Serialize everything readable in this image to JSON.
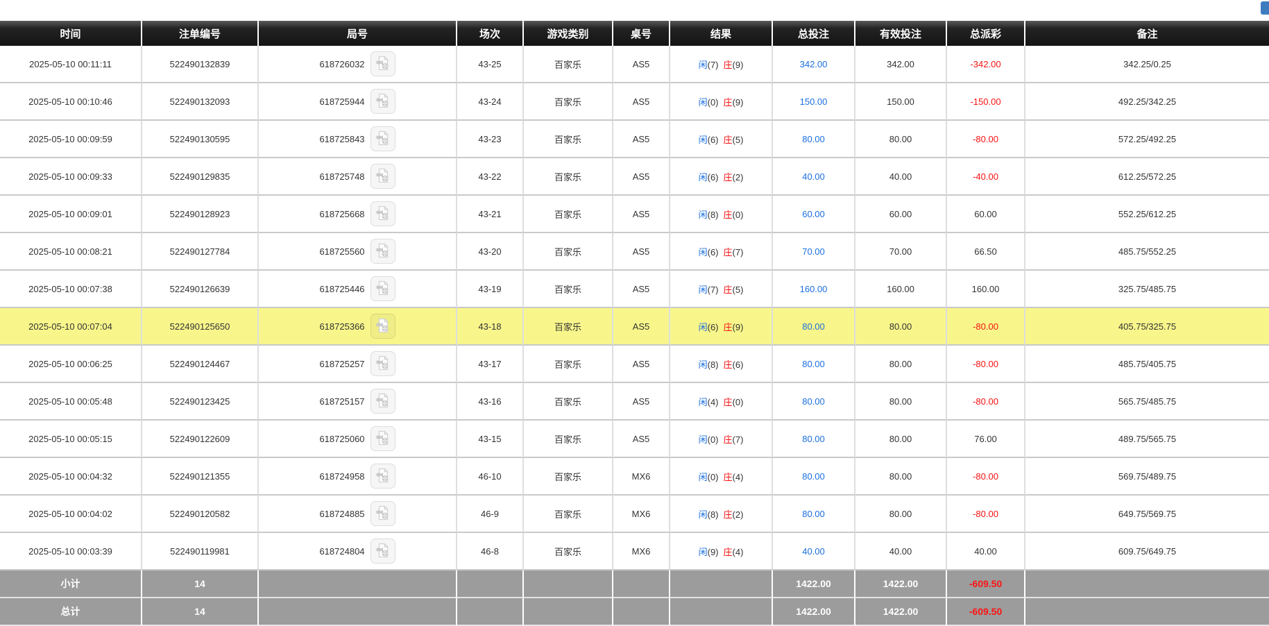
{
  "top_bar": {
    "partial_blue_button": {
      "visible": true,
      "color": "#3d7dbf"
    }
  },
  "table": {
    "columns": [
      {
        "key": "time",
        "label": "时间"
      },
      {
        "key": "bet_id",
        "label": "注单编号"
      },
      {
        "key": "round",
        "label": "局号"
      },
      {
        "key": "session",
        "label": "场次"
      },
      {
        "key": "game_type",
        "label": "游戏类别"
      },
      {
        "key": "table_no",
        "label": "桌号"
      },
      {
        "key": "result",
        "label": "结果"
      },
      {
        "key": "total_bet",
        "label": "总投注"
      },
      {
        "key": "valid_bet",
        "label": "有效投注"
      },
      {
        "key": "payout",
        "label": "总派彩"
      },
      {
        "key": "remark",
        "label": "备注"
      }
    ],
    "result_labels": {
      "player": "闲",
      "banker": "庄"
    },
    "rows": [
      {
        "time": "2025-05-10 00:11:11",
        "bet_id": "522490132839",
        "round": "618726032",
        "session": "43-25",
        "game": "百家乐",
        "table_no": "AS5",
        "p": "(7)",
        "b": "(9)",
        "total_bet": "342.00",
        "valid_bet": "342.00",
        "payout": "-342.00",
        "remark": "342.25/0.25",
        "highlight": false
      },
      {
        "time": "2025-05-10 00:10:46",
        "bet_id": "522490132093",
        "round": "618725944",
        "session": "43-24",
        "game": "百家乐",
        "table_no": "AS5",
        "p": "(0)",
        "b": "(9)",
        "total_bet": "150.00",
        "valid_bet": "150.00",
        "payout": "-150.00",
        "remark": "492.25/342.25",
        "highlight": false
      },
      {
        "time": "2025-05-10 00:09:59",
        "bet_id": "522490130595",
        "round": "618725843",
        "session": "43-23",
        "game": "百家乐",
        "table_no": "AS5",
        "p": "(6)",
        "b": "(5)",
        "total_bet": "80.00",
        "valid_bet": "80.00",
        "payout": "-80.00",
        "remark": "572.25/492.25",
        "highlight": false
      },
      {
        "time": "2025-05-10 00:09:33",
        "bet_id": "522490129835",
        "round": "618725748",
        "session": "43-22",
        "game": "百家乐",
        "table_no": "AS5",
        "p": "(6)",
        "b": "(2)",
        "total_bet": "40.00",
        "valid_bet": "40.00",
        "payout": "-40.00",
        "remark": "612.25/572.25",
        "highlight": false
      },
      {
        "time": "2025-05-10 00:09:01",
        "bet_id": "522490128923",
        "round": "618725668",
        "session": "43-21",
        "game": "百家乐",
        "table_no": "AS5",
        "p": "(8)",
        "b": "(0)",
        "total_bet": "60.00",
        "valid_bet": "60.00",
        "payout": "60.00",
        "remark": "552.25/612.25",
        "highlight": false
      },
      {
        "time": "2025-05-10 00:08:21",
        "bet_id": "522490127784",
        "round": "618725560",
        "session": "43-20",
        "game": "百家乐",
        "table_no": "AS5",
        "p": "(6)",
        "b": "(7)",
        "total_bet": "70.00",
        "valid_bet": "70.00",
        "payout": "66.50",
        "remark": "485.75/552.25",
        "highlight": false
      },
      {
        "time": "2025-05-10 00:07:38",
        "bet_id": "522490126639",
        "round": "618725446",
        "session": "43-19",
        "game": "百家乐",
        "table_no": "AS5",
        "p": "(7)",
        "b": "(5)",
        "total_bet": "160.00",
        "valid_bet": "160.00",
        "payout": "160.00",
        "remark": "325.75/485.75",
        "highlight": false
      },
      {
        "time": "2025-05-10 00:07:04",
        "bet_id": "522490125650",
        "round": "618725366",
        "session": "43-18",
        "game": "百家乐",
        "table_no": "AS5",
        "p": "(6)",
        "b": "(9)",
        "total_bet": "80.00",
        "valid_bet": "80.00",
        "payout": "-80.00",
        "remark": "405.75/325.75",
        "highlight": true
      },
      {
        "time": "2025-05-10 00:06:25",
        "bet_id": "522490124467",
        "round": "618725257",
        "session": "43-17",
        "game": "百家乐",
        "table_no": "AS5",
        "p": "(8)",
        "b": "(6)",
        "total_bet": "80.00",
        "valid_bet": "80.00",
        "payout": "-80.00",
        "remark": "485.75/405.75",
        "highlight": false
      },
      {
        "time": "2025-05-10 00:05:48",
        "bet_id": "522490123425",
        "round": "618725157",
        "session": "43-16",
        "game": "百家乐",
        "table_no": "AS5",
        "p": "(4)",
        "b": "(0)",
        "total_bet": "80.00",
        "valid_bet": "80.00",
        "payout": "-80.00",
        "remark": "565.75/485.75",
        "highlight": false
      },
      {
        "time": "2025-05-10 00:05:15",
        "bet_id": "522490122609",
        "round": "618725060",
        "session": "43-15",
        "game": "百家乐",
        "table_no": "AS5",
        "p": "(0)",
        "b": "(7)",
        "total_bet": "80.00",
        "valid_bet": "80.00",
        "payout": "76.00",
        "remark": "489.75/565.75",
        "highlight": false
      },
      {
        "time": "2025-05-10 00:04:32",
        "bet_id": "522490121355",
        "round": "618724958",
        "session": "46-10",
        "game": "百家乐",
        "table_no": "MX6",
        "p": "(0)",
        "b": "(4)",
        "total_bet": "80.00",
        "valid_bet": "80.00",
        "payout": "-80.00",
        "remark": "569.75/489.75",
        "highlight": false
      },
      {
        "time": "2025-05-10 00:04:02",
        "bet_id": "522490120582",
        "round": "618724885",
        "session": "46-9",
        "game": "百家乐",
        "table_no": "MX6",
        "p": "(8)",
        "b": "(2)",
        "total_bet": "80.00",
        "valid_bet": "80.00",
        "payout": "-80.00",
        "remark": "649.75/569.75",
        "highlight": false
      },
      {
        "time": "2025-05-10 00:03:39",
        "bet_id": "522490119981",
        "round": "618724804",
        "session": "46-8",
        "game": "百家乐",
        "table_no": "MX6",
        "p": "(9)",
        "b": "(4)",
        "total_bet": "40.00",
        "valid_bet": "40.00",
        "payout": "40.00",
        "remark": "609.75/649.75",
        "highlight": false
      }
    ],
    "footer": [
      {
        "label": "小计",
        "count": "14",
        "total_bet": "1422.00",
        "valid_bet": "1422.00",
        "payout": "-609.50"
      },
      {
        "label": "总计",
        "count": "14",
        "total_bet": "1422.00",
        "valid_bet": "1422.00",
        "payout": "-609.50"
      }
    ]
  },
  "colors": {
    "header_bg": "#1c1c1c",
    "footer_bg": "#9c9c9c",
    "highlight_row": "#f8f68b",
    "link_blue": "#1a6fe0",
    "loss_red": "#f51111",
    "top_button_blue": "#3d7dbf"
  }
}
